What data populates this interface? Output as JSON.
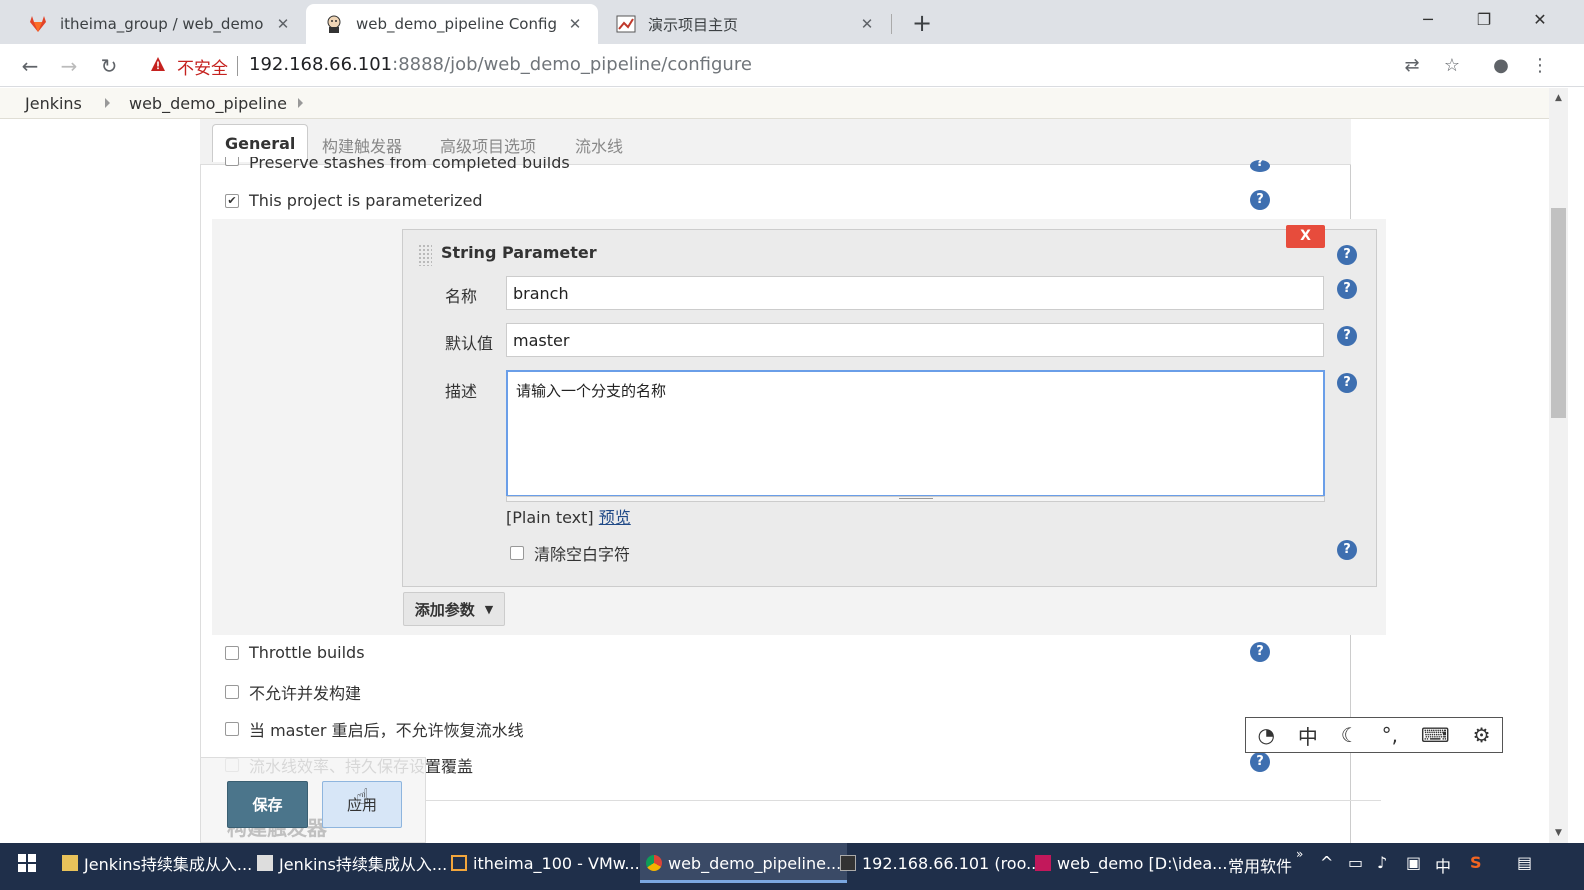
{
  "browser": {
    "tabs": [
      {
        "label": "itheima_group / web_demo · G",
        "icon": "gitlab-fox-icon"
      },
      {
        "label": "web_demo_pipeline Config [Je",
        "icon": "jenkins-butler-icon"
      },
      {
        "label": "演示项目主页",
        "icon": "page-image-icon"
      }
    ],
    "new_tab": "+",
    "window_controls": {
      "minimize": "─",
      "restore": "❐",
      "close": "✕"
    },
    "security_text": "不安全",
    "url_host": "192.168.66.101",
    "url_rest": ":8888/job/web_demo_pipeline/configure"
  },
  "breadcrumb": {
    "items": [
      "Jenkins",
      "web_demo_pipeline"
    ]
  },
  "config_tabs": [
    "General",
    "构建触发器",
    "高级项目选项",
    "流水线"
  ],
  "options": {
    "preserve_stashes": "Preserve stashes from completed builds",
    "parameterized": "This project is parameterized",
    "throttle": "Throttle builds",
    "no_concurrent": "不允许并发构建",
    "no_resume": "当 master 重启后，不允许恢复流水线",
    "durability": "流水线效率、持久保存设置覆盖"
  },
  "string_param": {
    "title": "String Parameter",
    "delete_label": "X",
    "name_label": "名称",
    "name_value": "branch",
    "default_label": "默认值",
    "default_value": "master",
    "desc_label": "描述",
    "desc_value": "请输入一个分支的名称",
    "plain_text": "[Plain text]",
    "preview_link": "预览",
    "trim_label": "清除空白字符"
  },
  "add_param": "添加参数",
  "buttons": {
    "save": "保存",
    "apply": "应用"
  },
  "faded_section": "构建触发器",
  "ime": {
    "mode": "中"
  },
  "taskbar": {
    "items": [
      "Jenkins持续集成从入...",
      "Jenkins持续集成从入...",
      "itheima_100 - VMw...",
      "web_demo_pipeline...",
      "192.168.66.101 (roo...",
      "web_demo [D:\\idea..."
    ],
    "tray_label": "常用软件",
    "ime_tray": "中"
  },
  "colors": {
    "accent": "#4b758b",
    "help": "#3e6fb0",
    "danger": "#e74c3c",
    "taskbar": "#1f2f4a"
  }
}
